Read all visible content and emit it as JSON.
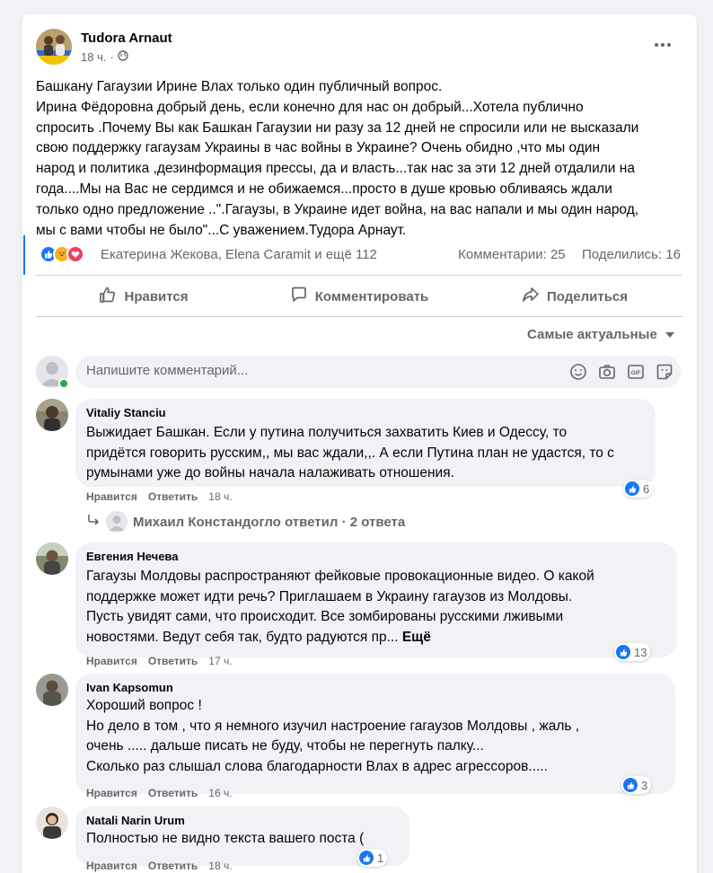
{
  "post": {
    "author": "Tudora Arnaut",
    "time": "18 ч.",
    "privacy_icon": "globe-icon",
    "lines": [
      "Башкану Гагаузии Ирине  Влах только один  публичный  вопрос.",
      "Ирина Фёдоровна добрый день, если конечно для нас он добрый...Хотела публично",
      "спросить .Почему Вы как Башкан Гагаузии ни разу за 12 дней не спросили или не высказали",
      "свою поддержку гагаузам Украины в час войны в Украине? Очень обидно ,что мы один",
      "народ и политика ,дезинформация прессы, да и власть...так нас за эти 12 дней отдалили на",
      "года....Мы на Вас не сердимся и не обижаемся...просто в душе кровью обливаясь ждали",
      "только одно предложение ..\".Гагаузы, в Украине идет война, на вас напали и мы один народ,",
      "мы с вами чтобы не было\"...С уважением.Тудора Арнаут."
    ]
  },
  "reactions": {
    "icons": [
      "like-icon",
      "care-icon",
      "love-icon"
    ],
    "names": "Екатерина Жекова, Elena Caramit и ещё 112",
    "comments_count": "Комментарии: 25",
    "shares_count": "Поделились: 16"
  },
  "actions": {
    "like": "Нравится",
    "comment": "Комментировать",
    "share": "Поделиться"
  },
  "sort_label": "Самые актуальные",
  "comment_box": {
    "placeholder": "Напишите комментарий..."
  },
  "colors": {
    "accent": "#1877f2",
    "secondary_text": "#65676b",
    "bubble_bg": "#f0f2f5",
    "page_bg": "#f0f2f5",
    "online": "#31a24c"
  },
  "comments": [
    {
      "author": "Vitaliy Stanciu",
      "lines": [
        "Выжидает Башкан. Если у путина получиться захватить Киев и Одессу, то",
        "придётся говорить русским,, мы вас ждали,,. А если Путина план не удастся, то с",
        "румынами уже до войны начала налаживать отношения."
      ],
      "like_label": "Нравится",
      "reply_label": "Ответить",
      "time": "18 ч.",
      "reaction_count": "6",
      "replies_text": "Михаил Констандогло ответил · 2 ответа"
    },
    {
      "author": "Евгения Нечева",
      "lines": [
        "Гагаузы Молдовы распространяют фейковые провокационные видео. О какой",
        "поддержке может идти речь? Приглашаем в Украину гагаузов из Молдовы.",
        "Пусть увидят сами, что происходит. Все зомбированы русскими лживыми",
        "новостями. Ведут себя так, будто радуются пр..."
      ],
      "more_label": "Ещё",
      "like_label": "Нравится",
      "reply_label": "Ответить",
      "time": "17 ч.",
      "reaction_count": "13"
    },
    {
      "author": "Ivan Kapsomun",
      "lines": [
        "Хороший вопрос !",
        "Но дело в том , что я немного изучил настроение гагаузов Молдовы , жаль ,",
        "очень ..... дальше писать не буду, чтобы не перегнуть палку...",
        "Сколько раз слышал слова благодарности Влах в адрес агрессоров....."
      ],
      "like_label": "Нравится",
      "reply_label": "Ответить",
      "time": "16 ч.",
      "reaction_count": "3"
    },
    {
      "author": "Natali Narin Urum",
      "lines": [
        "Полностью не видно текста вашего поста ("
      ],
      "like_label": "Нравится",
      "reply_label": "Ответить",
      "time": "18 ч.",
      "reaction_count": "1"
    }
  ]
}
